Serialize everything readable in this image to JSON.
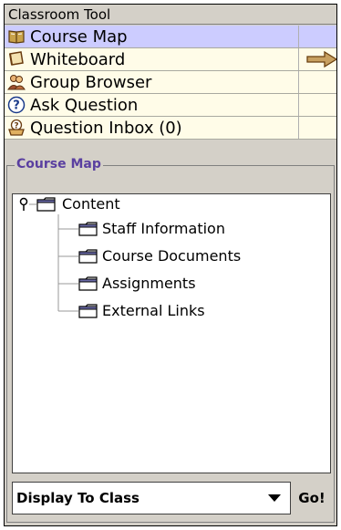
{
  "tool": {
    "title": "Classroom Tool"
  },
  "menu": {
    "items": [
      {
        "label": "Course Map",
        "icon": "book-icon",
        "selected": true
      },
      {
        "label": "Whiteboard",
        "icon": "whiteboard-icon",
        "selected": false
      },
      {
        "label": "Group Browser",
        "icon": "group-icon",
        "selected": false
      },
      {
        "label": "Ask Question",
        "icon": "question-icon",
        "selected": false
      },
      {
        "label": "Question Inbox (0)",
        "icon": "inbox-icon",
        "selected": false
      }
    ],
    "arrow_icon": "right-arrow-icon"
  },
  "course_map": {
    "label": "Course Map",
    "root": {
      "label": "Content",
      "icon": "folder-icon"
    },
    "children": [
      {
        "label": "Staff Information",
        "icon": "folder-icon"
      },
      {
        "label": "Course Documents",
        "icon": "folder-icon"
      },
      {
        "label": "Assignments",
        "icon": "folder-icon"
      },
      {
        "label": "External Links",
        "icon": "folder-icon"
      }
    ]
  },
  "display": {
    "selected": "Display To Class",
    "go_label": "Go!"
  },
  "colors": {
    "selected_row": "#ccccff",
    "row_bg": "#fffce8",
    "panel_bg": "#d4d0c8",
    "group_label": "#5a3fa0",
    "arrow": "#c8a060"
  }
}
